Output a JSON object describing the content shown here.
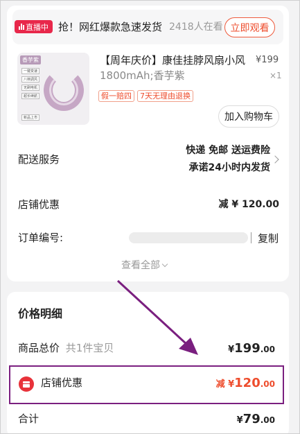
{
  "live": {
    "badge": "直播中",
    "headline": "抢！网红爆款急速发货",
    "viewers": "2418人在看",
    "watch_button": "立即观看"
  },
  "product": {
    "image_tag": "香芋紫",
    "image_features": [
      "一键变速",
      "八档调风",
      "无刷电机",
      "超长续航"
    ],
    "image_badge": "新品上市",
    "title": "【周年庆价】康佳挂脖风扇小风",
    "price": "¥199",
    "spec": "1800mAh;香芋紫",
    "quantity": "×1",
    "tags": [
      "假一赔四",
      "7天无理由退换"
    ],
    "cart_button": "加入购物车"
  },
  "delivery": {
    "label": "配送服务",
    "line1": "快递 免邮 送运费险",
    "line2": "承诺24小时内发货"
  },
  "shop_discount": {
    "label": "店铺优惠",
    "value": "减 ¥ 120.00"
  },
  "order": {
    "label": "订单编号:",
    "copy": "复制",
    "see_all": "查看全部"
  },
  "price_detail": {
    "title": "价格明细",
    "goods_label": "商品总价",
    "goods_sub": "共1件宝贝",
    "goods_cur": "¥",
    "goods_int": "199",
    "goods_dec": ".00",
    "shop_label": "店铺优惠",
    "shop_prefix": "减 ¥",
    "shop_int": "120",
    "shop_dec": ".00",
    "total_label": "合计",
    "total_cur": "¥",
    "total_int": "79",
    "total_dec": ".00"
  },
  "colors": {
    "accent_red": "#ee4d2d",
    "live_red": "#e8284b",
    "annotation_purple": "#7a1f7f"
  }
}
